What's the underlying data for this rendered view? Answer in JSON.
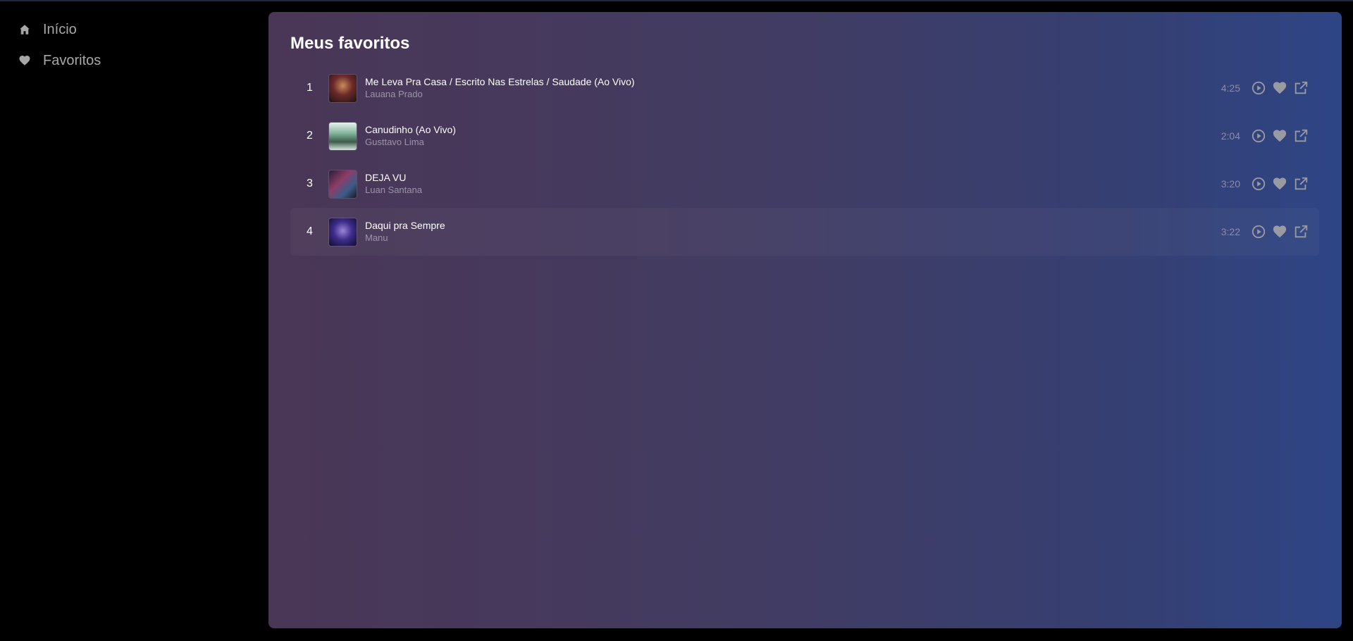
{
  "sidebar": {
    "items": [
      {
        "label": "Início",
        "icon": "home-icon"
      },
      {
        "label": "Favoritos",
        "icon": "heart-icon"
      }
    ]
  },
  "main": {
    "title": "Meus favoritos",
    "tracks": [
      {
        "number": "1",
        "title": "Me Leva Pra Casa / Escrito Nas Estrelas / Saudade (Ao Vivo)",
        "artist": "Lauana Prado",
        "duration": "4:25"
      },
      {
        "number": "2",
        "title": "Canudinho (Ao Vivo)",
        "artist": "Gusttavo Lima",
        "duration": "2:04"
      },
      {
        "number": "3",
        "title": "DEJA VU",
        "artist": "Luan Santana",
        "duration": "3:20"
      },
      {
        "number": "4",
        "title": "Daqui pra Sempre",
        "artist": "Manu",
        "duration": "3:22"
      }
    ]
  },
  "colors": {
    "background": "#000000",
    "panel_gradient_start": "#4a3656",
    "panel_gradient_end": "#2e4585",
    "muted_text": "#a7a7a7",
    "icon_gray": "#9a9aa2"
  }
}
